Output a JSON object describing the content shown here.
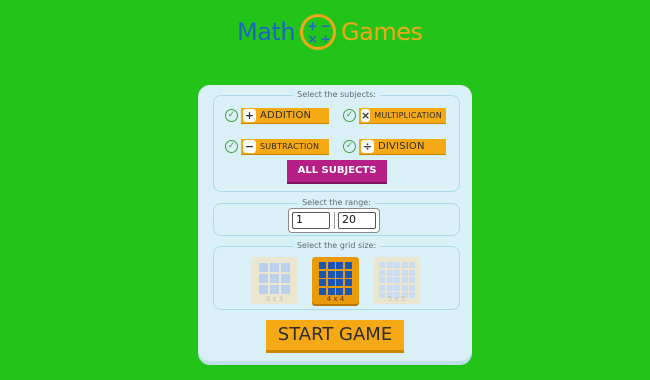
{
  "logo": {
    "word1": "Math",
    "word2": "Games",
    "icon": "math-operations-badge-icon",
    "glyphs": [
      "+",
      "−",
      "×",
      "÷"
    ]
  },
  "subjects": {
    "label": "Select the subjects:",
    "items": [
      {
        "label": "ADDITION",
        "symbol": "+",
        "checked": true
      },
      {
        "label": "MULTIPLICATION",
        "symbol": "×",
        "checked": true
      },
      {
        "label": "SUBTRACTION",
        "symbol": "−",
        "checked": true
      },
      {
        "label": "DIVISION",
        "symbol": "÷",
        "checked": true
      }
    ],
    "all_label": "ALL SUBJECTS"
  },
  "range": {
    "label": "Select the range:",
    "min": "1",
    "max": "20"
  },
  "grid": {
    "label": "Select the grid size:",
    "options": [
      {
        "caption": "3 x 3",
        "selected": false
      },
      {
        "caption": "4 x 4",
        "selected": true
      },
      {
        "caption": "5 x 5",
        "selected": false
      }
    ]
  },
  "start_label": "START GAME",
  "colors": {
    "background": "#22c41a",
    "accent": "#f5a915",
    "all_button": "#b51f86",
    "logo_blue": "#1e63c8"
  }
}
